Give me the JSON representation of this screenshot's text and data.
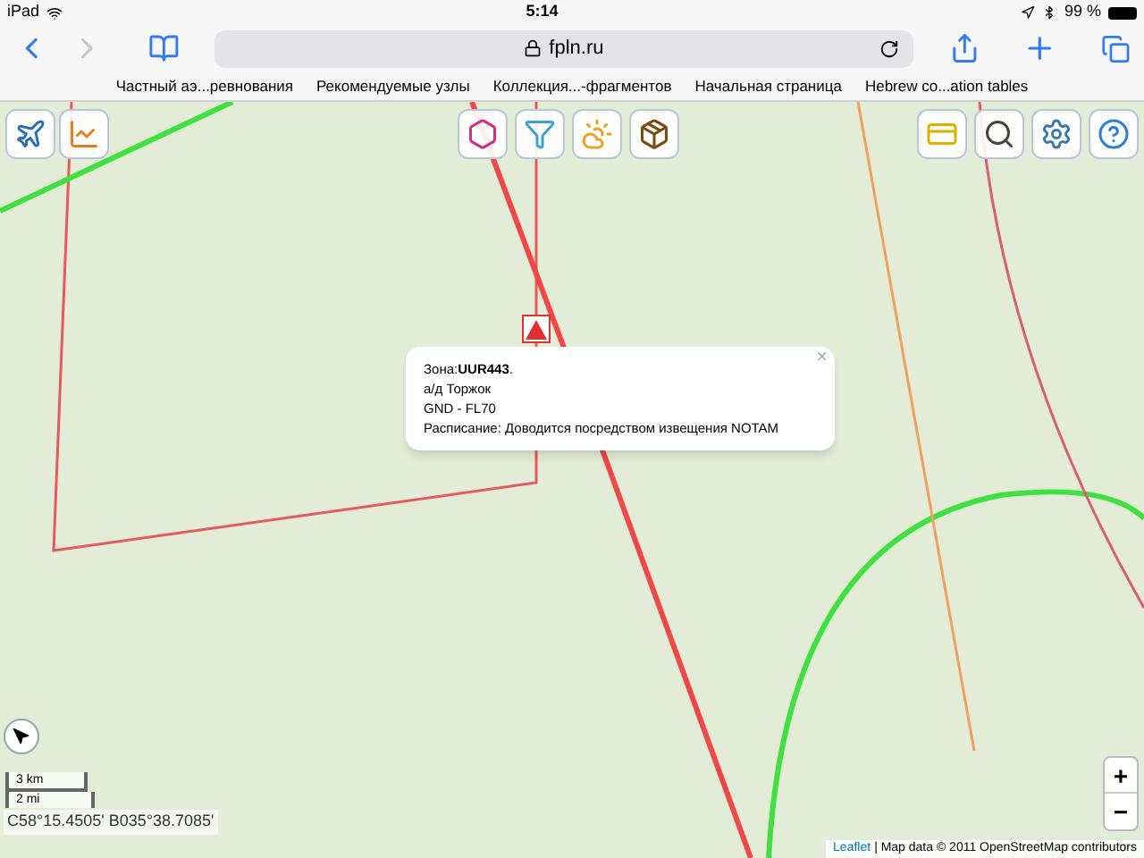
{
  "status_bar": {
    "device": "iPad",
    "time": "5:14",
    "battery": "99 %"
  },
  "browser": {
    "url": "fpln.ru",
    "bookmarks": [
      "Частный аэ...ревнования",
      "Рекомендуемые узлы",
      "Коллекция...-фрагментов",
      "Начальная страница",
      "Hebrew co...ation tables"
    ]
  },
  "popup": {
    "close": "×",
    "lines": [
      "Зона:**UUR443**.",
      "а/д Торжок",
      "GND - FL70",
      "Расписание: Доводится посредством извещения NOTAM"
    ]
  },
  "scale": {
    "metric": "3 km",
    "imperial": "2 mi"
  },
  "coordinates": "С58°15.4505' В035°38.7085'",
  "zoom": {
    "in": "+",
    "out": "−"
  },
  "attribution": {
    "link": "Leaflet",
    "text": "| Map data © 2011 OpenStreetMap contributors"
  }
}
